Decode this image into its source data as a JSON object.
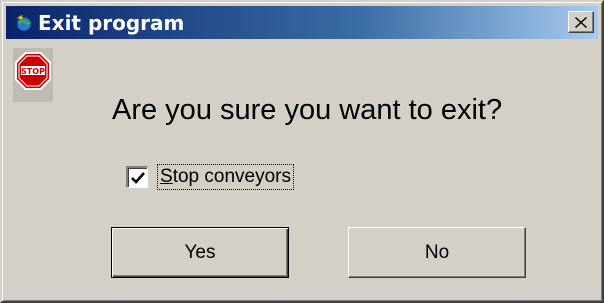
{
  "window": {
    "title": "Exit program",
    "close_label": "x"
  },
  "dialog": {
    "icon": "stop-sign-icon",
    "question": "Are you sure you want to exit?",
    "checkbox": {
      "label_accel": "S",
      "label_rest": "top conveyors",
      "checked": true
    },
    "buttons": {
      "yes": "Yes",
      "no": "No"
    }
  },
  "colors": {
    "titlebar_start": "#0a246a",
    "titlebar_end": "#a6caf0",
    "face": "#d4d0c8",
    "stop_red": "#cc0000"
  }
}
